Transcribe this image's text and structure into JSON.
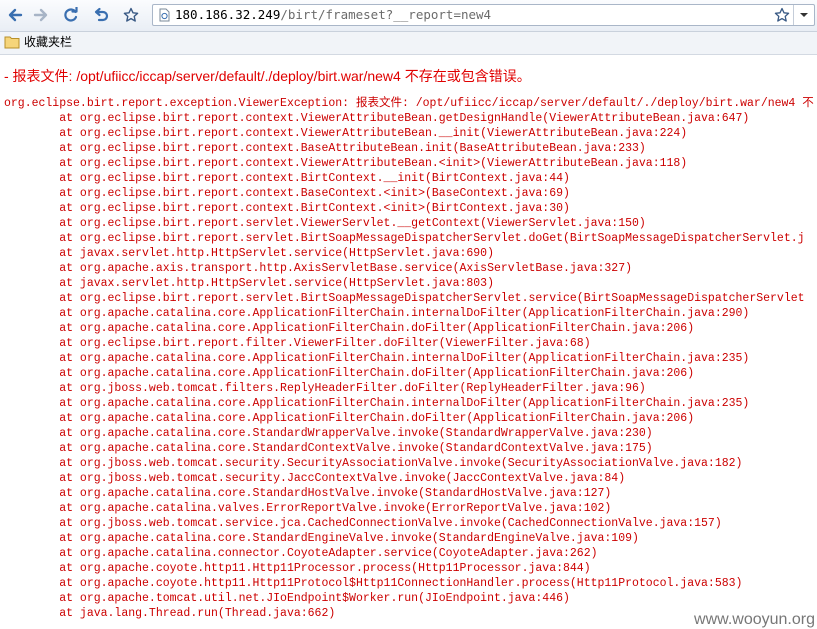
{
  "browser": {
    "url_host": "180.186.32.249",
    "url_path": "/birt/frameset?__report=new4",
    "bookmarks": [
      {
        "label": "收藏夹栏",
        "icon": "folder-icon"
      }
    ],
    "icons": [
      "back-arrow-icon",
      "forward-arrow-icon",
      "reload-icon",
      "undo-icon",
      "star-icon",
      "page-icon",
      "star-icon",
      "chevron-down-icon"
    ]
  },
  "page": {
    "error_title": "- 报表文件: /opt/ufiicc/iccap/server/default/./deploy/birt.war/new4 不存在或包含错误。",
    "stack_trace": [
      "org.eclipse.birt.report.exception.ViewerException: 报表文件: /opt/ufiicc/iccap/server/default/./deploy/birt.war/new4 不",
      "        at org.eclipse.birt.report.context.ViewerAttributeBean.getDesignHandle(ViewerAttributeBean.java:647)",
      "        at org.eclipse.birt.report.context.ViewerAttributeBean.__init(ViewerAttributeBean.java:224)",
      "        at org.eclipse.birt.report.context.BaseAttributeBean.init(BaseAttributeBean.java:233)",
      "        at org.eclipse.birt.report.context.ViewerAttributeBean.<init>(ViewerAttributeBean.java:118)",
      "        at org.eclipse.birt.report.context.BirtContext.__init(BirtContext.java:44)",
      "        at org.eclipse.birt.report.context.BaseContext.<init>(BaseContext.java:69)",
      "        at org.eclipse.birt.report.context.BirtContext.<init>(BirtContext.java:30)",
      "        at org.eclipse.birt.report.servlet.ViewerServlet.__getContext(ViewerServlet.java:150)",
      "        at org.eclipse.birt.report.servlet.BirtSoapMessageDispatcherServlet.doGet(BirtSoapMessageDispatcherServlet.j",
      "        at javax.servlet.http.HttpServlet.service(HttpServlet.java:690)",
      "        at org.apache.axis.transport.http.AxisServletBase.service(AxisServletBase.java:327)",
      "        at javax.servlet.http.HttpServlet.service(HttpServlet.java:803)",
      "        at org.eclipse.birt.report.servlet.BirtSoapMessageDispatcherServlet.service(BirtSoapMessageDispatcherServlet",
      "        at org.apache.catalina.core.ApplicationFilterChain.internalDoFilter(ApplicationFilterChain.java:290)",
      "        at org.apache.catalina.core.ApplicationFilterChain.doFilter(ApplicationFilterChain.java:206)",
      "        at org.eclipse.birt.report.filter.ViewerFilter.doFilter(ViewerFilter.java:68)",
      "        at org.apache.catalina.core.ApplicationFilterChain.internalDoFilter(ApplicationFilterChain.java:235)",
      "        at org.apache.catalina.core.ApplicationFilterChain.doFilter(ApplicationFilterChain.java:206)",
      "        at org.jboss.web.tomcat.filters.ReplyHeaderFilter.doFilter(ReplyHeaderFilter.java:96)",
      "        at org.apache.catalina.core.ApplicationFilterChain.internalDoFilter(ApplicationFilterChain.java:235)",
      "        at org.apache.catalina.core.ApplicationFilterChain.doFilter(ApplicationFilterChain.java:206)",
      "        at org.apache.catalina.core.StandardWrapperValve.invoke(StandardWrapperValve.java:230)",
      "        at org.apache.catalina.core.StandardContextValve.invoke(StandardContextValve.java:175)",
      "        at org.jboss.web.tomcat.security.SecurityAssociationValve.invoke(SecurityAssociationValve.java:182)",
      "        at org.jboss.web.tomcat.security.JaccContextValve.invoke(JaccContextValve.java:84)",
      "        at org.apache.catalina.core.StandardHostValve.invoke(StandardHostValve.java:127)",
      "        at org.apache.catalina.valves.ErrorReportValve.invoke(ErrorReportValve.java:102)",
      "        at org.jboss.web.tomcat.service.jca.CachedConnectionValve.invoke(CachedConnectionValve.java:157)",
      "        at org.apache.catalina.core.StandardEngineValve.invoke(StandardEngineValve.java:109)",
      "        at org.apache.catalina.connector.CoyoteAdapter.service(CoyoteAdapter.java:262)",
      "        at org.apache.coyote.http11.Http11Processor.process(Http11Processor.java:844)",
      "        at org.apache.coyote.http11.Http11Protocol$Http11ConnectionHandler.process(Http11Protocol.java:583)",
      "        at org.apache.tomcat.util.net.JIoEndpoint$Worker.run(JIoEndpoint.java:446)",
      "        at java.lang.Thread.run(Thread.java:662)"
    ],
    "watermark": "www.wooyun.org"
  },
  "colors": {
    "error_red": "#cc0000",
    "title_red": "#e00000",
    "toolbar_bg": "#e9eef5",
    "icon_blue": "#3a6fb0"
  }
}
